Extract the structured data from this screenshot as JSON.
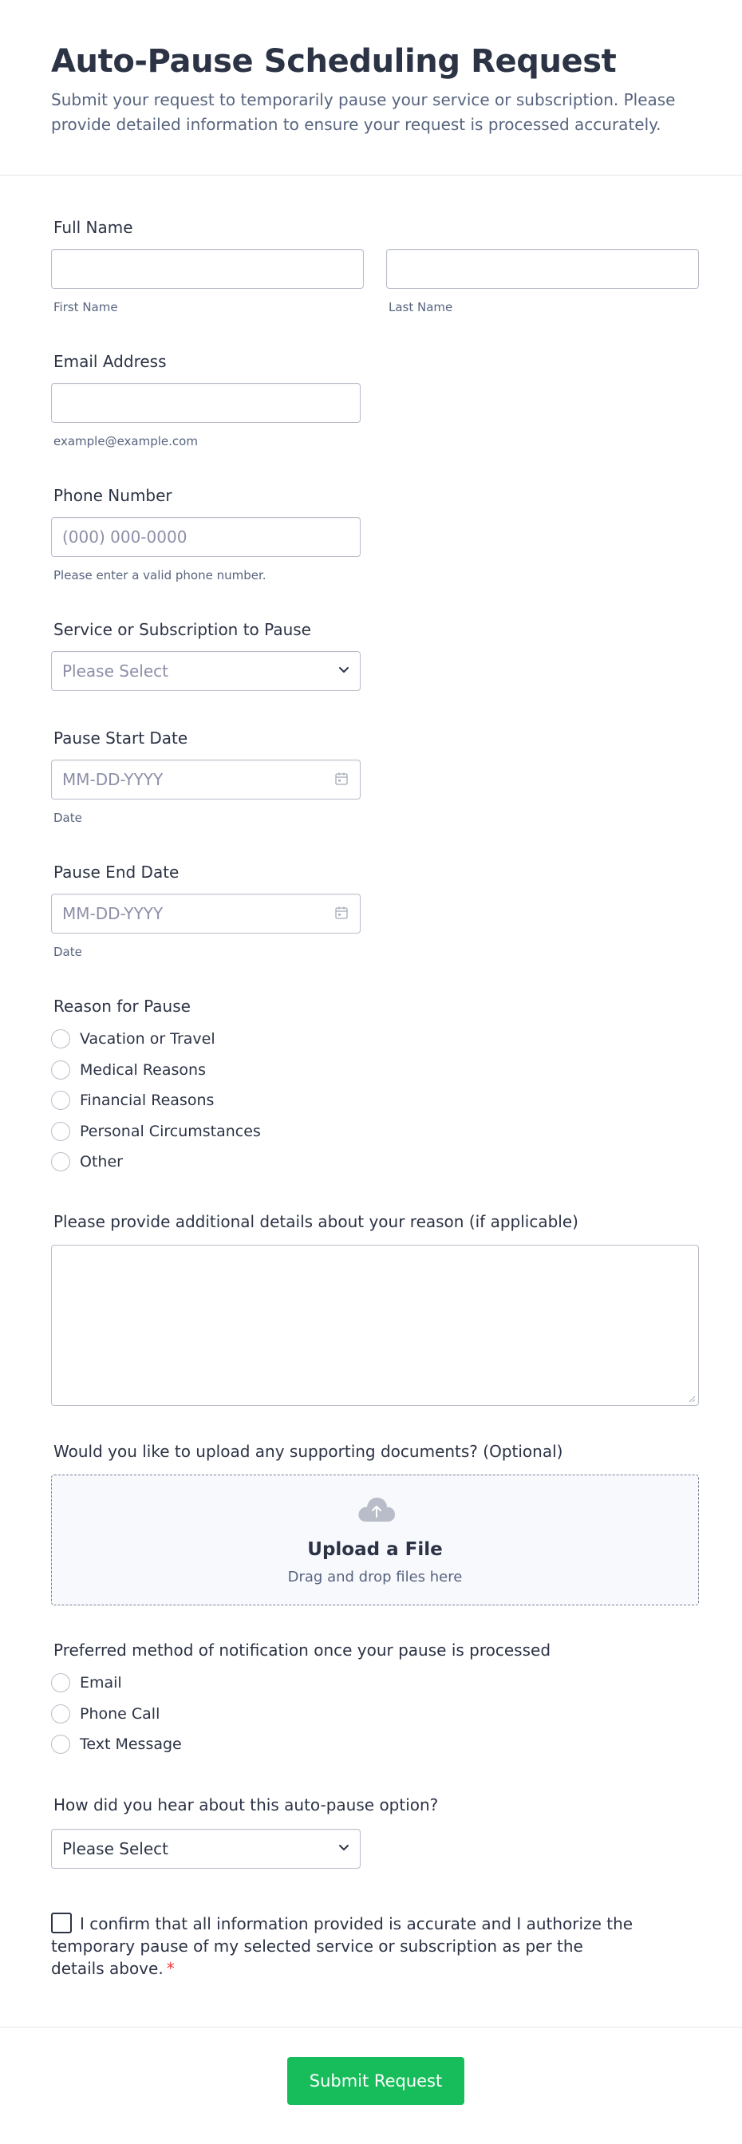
{
  "form": {
    "title": "Auto-Pause Scheduling Request",
    "subtitle": "Submit your request to temporarily pause your service or subscription. Please provide detailed information to ensure your request is processed accurately."
  },
  "full_name": {
    "label": "Full Name",
    "first_sublabel": "First Name",
    "last_sublabel": "Last Name",
    "first_value": "",
    "last_value": ""
  },
  "email": {
    "label": "Email Address",
    "sublabel": "example@example.com",
    "value": ""
  },
  "phone": {
    "label": "Phone Number",
    "placeholder": "(000) 000-0000",
    "sublabel": "Please enter a valid phone number."
  },
  "service": {
    "label": "Service or Subscription to Pause",
    "selected": "Please Select"
  },
  "pause_start": {
    "label": "Pause Start Date",
    "placeholder": "MM-DD-YYYY",
    "sublabel": "Date"
  },
  "pause_end": {
    "label": "Pause End Date",
    "placeholder": "MM-DD-YYYY",
    "sublabel": "Date"
  },
  "reason": {
    "label": "Reason for Pause",
    "options": [
      "Vacation or Travel",
      "Medical Reasons",
      "Financial Reasons",
      "Personal Circumstances",
      "Other"
    ]
  },
  "details": {
    "label": "Please provide additional details about your reason (if applicable)",
    "value": ""
  },
  "upload": {
    "label": "Would you like to upload any supporting documents? (Optional)",
    "title": "Upload a File",
    "subtitle": "Drag and drop files here"
  },
  "notification": {
    "label": "Preferred method of notification once your pause is processed",
    "options": [
      "Email",
      "Phone Call",
      "Text Message"
    ]
  },
  "source": {
    "label": "How did you hear about this auto-pause option?",
    "selected": "Please Select"
  },
  "confirm": {
    "text": "I confirm that all information provided is accurate and I authorize the temporary pause of my selected service or subscription as per the details above.",
    "required_mark": "*"
  },
  "submit_label": "Submit Request",
  "colors": {
    "accent": "#18bd5b",
    "text": "#2c3345",
    "muted": "#57647e",
    "border": "#b8bdc9",
    "required": "#f23a3c"
  },
  "icons": {
    "select": "chevron-down-icon",
    "date": "calendar-icon",
    "upload": "cloud-upload-icon"
  }
}
